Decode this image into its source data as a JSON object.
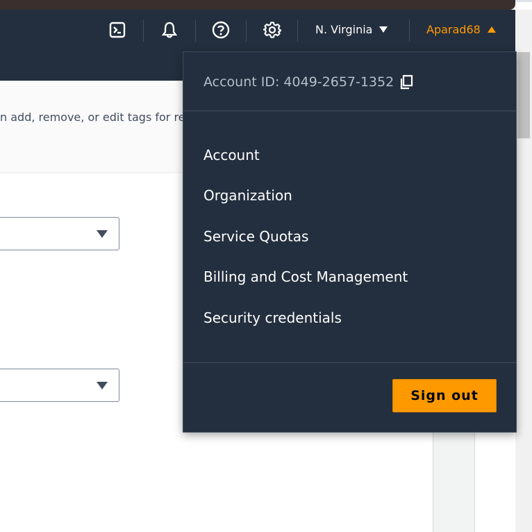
{
  "top_nav": {
    "cloudshell_icon": "terminal-icon",
    "notifications_icon": "bell-icon",
    "help_icon": "help-icon",
    "settings_icon": "gear-icon",
    "region_label": "N. Virginia",
    "user_label": "Aparad68",
    "user_color": "#ff9900"
  },
  "page": {
    "intro_text": "n add, remove, or edit tags for res"
  },
  "account_menu": {
    "account_id_label": "Account ID: 4049-2657-1352",
    "items": [
      {
        "label": "Account"
      },
      {
        "label": "Organization"
      },
      {
        "label": "Service Quotas"
      },
      {
        "label": "Billing and Cost Management"
      },
      {
        "label": "Security credentials"
      }
    ],
    "sign_out_label": "Sign out",
    "sign_out_color": "#ff9900"
  }
}
